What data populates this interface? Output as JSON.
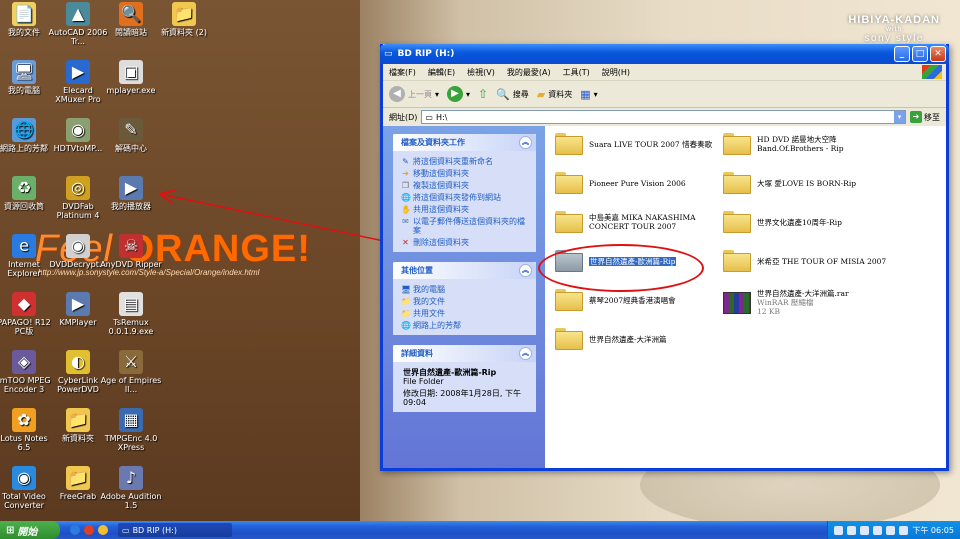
{
  "desktop": {
    "brand_line1": "HIBIYA-KADAN",
    "brand_line2": "with",
    "brand_line3": "sony style",
    "orange_feel": "Feel",
    "orange_word": "ORANGE!",
    "orange_url": "http://www.jp.sonystyle.com/Style-a/Special/Orange/index.html",
    "icons": [
      {
        "label": "我的文件",
        "icon": "documents-icon",
        "glyph": "📄",
        "color": "#f0d060"
      },
      {
        "label": "AutoCAD 2006 Tr...",
        "icon": "autocad-icon",
        "glyph": "▲",
        "color": "#4a8a9a"
      },
      {
        "label": "閱讀暗站",
        "icon": "reader-icon",
        "glyph": "🔍",
        "color": "#e07020"
      },
      {
        "label": "新資料夾 (2)",
        "icon": "folder-icon",
        "glyph": "📁",
        "color": "#f0c850"
      },
      {
        "label": "我的電腦",
        "icon": "my-computer-icon",
        "glyph": "🖥",
        "color": "#6a9ad8"
      },
      {
        "label": "Elecard XMuxer Pro",
        "icon": "elecard-icon",
        "glyph": "▶",
        "color": "#2a6ad0"
      },
      {
        "label": "mplayer.exe",
        "icon": "mplayer-icon",
        "glyph": "▣",
        "color": "#dddddd"
      },
      {
        "label": "網路上的芳鄰",
        "icon": "network-icon",
        "glyph": "🌐",
        "color": "#5a9ad8"
      },
      {
        "label": "HDTVtoMP...",
        "icon": "hdtv-icon",
        "glyph": "◉",
        "color": "#8aa070"
      },
      {
        "label": "解碼中心",
        "icon": "decoder-icon",
        "glyph": "✎",
        "color": "#6a5a3a"
      },
      {
        "label": "資源回收筒",
        "icon": "recycle-bin-icon",
        "glyph": "♻",
        "color": "#6ab06a"
      },
      {
        "label": "DVDFab Platinum 4",
        "icon": "dvdfab-icon",
        "glyph": "◎",
        "color": "#d0a020"
      },
      {
        "label": "我的播放器",
        "icon": "player-icon",
        "glyph": "▶",
        "color": "#5a7ab0"
      },
      {
        "label": "Internet Explorer",
        "icon": "ie-icon",
        "glyph": "e",
        "color": "#2a7ae0"
      },
      {
        "label": "DVDDecrypt...",
        "icon": "dvddecrypt-icon",
        "glyph": "◉",
        "color": "#d0d0d0"
      },
      {
        "label": "AnyDVD Ripper",
        "icon": "anydvd-icon",
        "glyph": "☠",
        "color": "#c03030"
      },
      {
        "label": "PAPAGO! R12 PC版",
        "icon": "papago-icon",
        "glyph": "◆",
        "color": "#d03030"
      },
      {
        "label": "KMPlayer",
        "icon": "kmplayer-icon",
        "glyph": "▶",
        "color": "#5a7ab0"
      },
      {
        "label": "TsRemux 0.0.1.9.exe",
        "icon": "tsremux-icon",
        "glyph": "▤",
        "color": "#e0e0e0"
      },
      {
        "label": "ImTOO MPEG Encoder 3",
        "icon": "imtoo-icon",
        "glyph": "◈",
        "color": "#6a5a9a"
      },
      {
        "label": "CyberLink PowerDVD",
        "icon": "powerdvd-icon",
        "glyph": "◐",
        "color": "#e0c030"
      },
      {
        "label": "Age of Empires II...",
        "icon": "age-of-empires-icon",
        "glyph": "⚔",
        "color": "#8a6a3a"
      },
      {
        "label": "Lotus Notes 6.5",
        "icon": "lotus-notes-icon",
        "glyph": "✿",
        "color": "#f0a020"
      },
      {
        "label": "新資料夾",
        "icon": "folder-icon",
        "glyph": "📁",
        "color": "#f0c850"
      },
      {
        "label": "TMPGEnc 4.0 XPress",
        "icon": "tmpgenc-icon",
        "glyph": "▦",
        "color": "#3a6ab0"
      },
      {
        "label": "Total Video Converter",
        "icon": "total-video-icon",
        "glyph": "◉",
        "color": "#2a8ae0"
      },
      {
        "label": "FreeGrab",
        "icon": "freegrab-icon",
        "glyph": "📁",
        "color": "#f0c850"
      },
      {
        "label": "Adobe Audition 1.5",
        "icon": "audition-icon",
        "glyph": "♪",
        "color": "#6a7ab0"
      }
    ]
  },
  "window": {
    "title": "BD RIP (H:)",
    "menu": [
      "檔案(F)",
      "編輯(E)",
      "檢視(V)",
      "我的最愛(A)",
      "工具(T)",
      "說明(H)"
    ],
    "toolbar": {
      "back": "上一頁",
      "search": "搜尋",
      "folders": "資料夾"
    },
    "address": {
      "label": "網址(D)",
      "value": "H:\\",
      "go": "移至"
    },
    "tasks": {
      "title": "檔案及資料夾工作",
      "items": [
        "將這個資料夾重新命名",
        "移動這個資料夾",
        "複製這個資料夾",
        "將這個資料夾發佈到網站",
        "共用這個資料夾",
        "以電子郵件傳送這個資料夾的檔案",
        "刪除這個資料夾"
      ]
    },
    "places": {
      "title": "其他位置",
      "items": [
        "我的電腦",
        "我的文件",
        "共用文件",
        "網路上的芳鄰"
      ]
    },
    "details": {
      "title": "詳細資料",
      "name": "世界自然遺產-歐洲篇-Rip",
      "type": "File Folder",
      "modified": "修改日期: 2008年1月28日, 下午 09:04"
    },
    "files": [
      {
        "name": "Suara LIVE TOUR 2007 惜春奏歌",
        "sub": "",
        "kind": "folder"
      },
      {
        "name": "HD DVD 諾曼地大空降 Band.Of.Brothers - Rip",
        "sub": "",
        "kind": "folder"
      },
      {
        "name": "Pioneer Pure Vision 2006",
        "sub": "",
        "kind": "folder"
      },
      {
        "name": "大塚 愛LOVE IS BORN-Rip",
        "sub": "",
        "kind": "folder"
      },
      {
        "name": "中島美嘉 MIKA NAKASHIMA CONCERT TOUR 2007",
        "sub": "",
        "kind": "folder"
      },
      {
        "name": "世界文化遺產10周年-Rip",
        "sub": "",
        "kind": "folder"
      },
      {
        "name": "世界自然遺產-歐洲篇-Rip",
        "sub": "",
        "kind": "folder-selected"
      },
      {
        "name": "米希亞 THE TOUR OF MISIA 2007",
        "sub": "",
        "kind": "folder"
      },
      {
        "name": "蔡琴2007經典香港演唱會",
        "sub": "",
        "kind": "folder"
      },
      {
        "name": "世界自然遺產-大洋洲篇.rar",
        "sub": "WinRAR 壓縮檔\n12 KB",
        "kind": "rar"
      },
      {
        "name": "世界自然遺產-大洋洲篇",
        "sub": "",
        "kind": "folder"
      }
    ]
  },
  "taskbar": {
    "start": "開始",
    "task": "BD RIP (H:)",
    "clock": "下午 06:05"
  }
}
